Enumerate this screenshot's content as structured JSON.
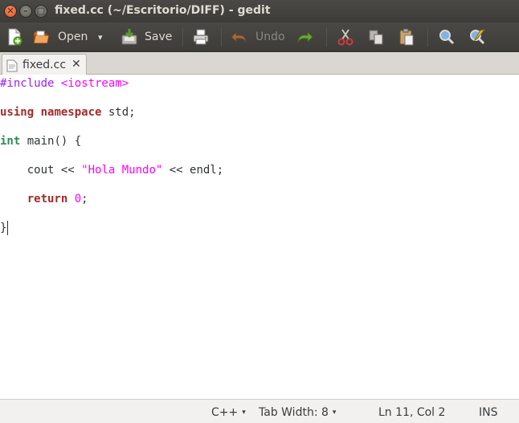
{
  "window": {
    "title": "fixed.cc (~/Escritorio/DIFF) - gedit",
    "close_glyph": "✕",
    "minimize_glyph": "–",
    "maximize_glyph": "□"
  },
  "toolbar": {
    "new_icon": "new-document-icon",
    "open_label": "Open",
    "open_menu_glyph": "▾",
    "save_label": "Save",
    "print_icon": "print-icon",
    "undo_label": "Undo",
    "redo_icon": "redo-icon",
    "cut_icon": "cut-icon",
    "copy_icon": "copy-icon",
    "paste_icon": "paste-icon",
    "find_icon": "find-icon",
    "replace_icon": "find-replace-icon"
  },
  "tab": {
    "label": "fixed.cc",
    "close_glyph": "✕"
  },
  "editor": {
    "lines": [
      {
        "pp": "#include ",
        "inc": "<iostream>"
      },
      {
        "kw1": "using",
        "sp": " ",
        "kw2": "namespace",
        "rest": " std;"
      },
      {
        "ty": "int",
        "rest": " main() {"
      },
      {
        "indent": "    ",
        "a": "cout << ",
        "str": "\"Hola Mundo\"",
        "b": " << endl;"
      },
      {
        "indent": "    ",
        "kw": "return",
        "sp": " ",
        "num": "0",
        "rest": ";"
      },
      {
        "rest": "}"
      }
    ],
    "colors": {
      "preprocessor": "#a020f0",
      "string": "#ff00ff",
      "keyword": "#a52a2a",
      "type": "#2e8b57"
    }
  },
  "statusbar": {
    "language": "C++",
    "tab_width": "Tab Width: 8",
    "position": "Ln 11, Col 2",
    "mode": "INS",
    "dropdown_glyph": "▾"
  }
}
